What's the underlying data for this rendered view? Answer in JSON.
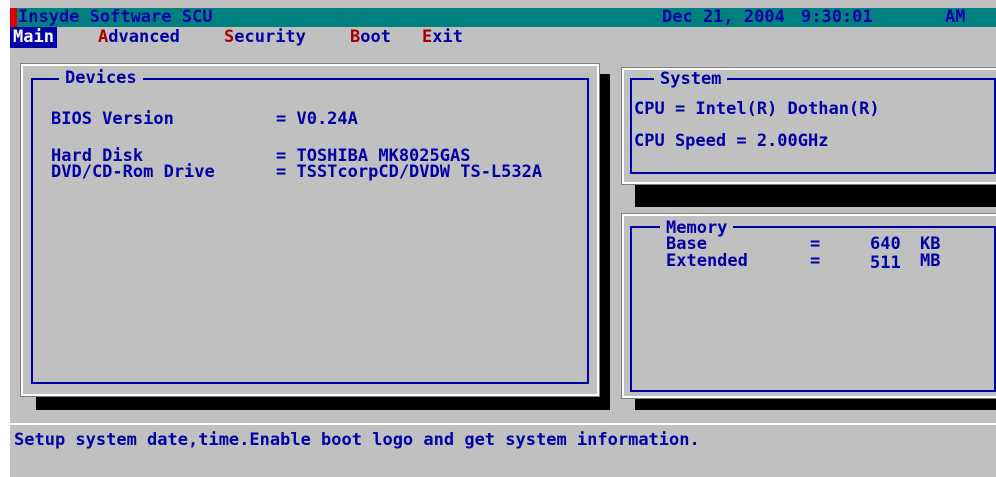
{
  "title_bar": {
    "app_name": "Insyde Software SCU",
    "date": "Dec 21, 2004",
    "time": "9:30:01",
    "ampm": "AM"
  },
  "menu": {
    "main": {
      "hot": "M",
      "rest": "ain"
    },
    "advanced": {
      "hot": "A",
      "rest": "dvanced"
    },
    "security": {
      "hot": "S",
      "rest": "ecurity"
    },
    "boot": {
      "hot": "B",
      "rest": "oot"
    },
    "exit": {
      "hot": "E",
      "rest": "xit"
    }
  },
  "devices": {
    "legend": "Devices",
    "bios_label": "BIOS Version",
    "bios_value": "= V0.24A",
    "hdd_label": "Hard Disk",
    "hdd_value": "= TOSHIBA MK8025GAS",
    "dvd_label": "DVD/CD-Rom Drive",
    "dvd_value": "= TSSTcorpCD/DVDW TS-L532A"
  },
  "system": {
    "legend": "System",
    "cpu": "CPU = Intel(R) Dothan(R)",
    "cpu_speed": "CPU Speed = 2.00GHz"
  },
  "memory": {
    "legend": "Memory",
    "base_label": "Base",
    "base_eq": "=",
    "base_value": "640",
    "base_unit": "KB",
    "ext_label": "Extended",
    "ext_eq": "=",
    "ext_value": "511",
    "ext_unit": "MB"
  },
  "status_bar": {
    "text": "Setup system date,time.Enable boot logo and get system information."
  }
}
